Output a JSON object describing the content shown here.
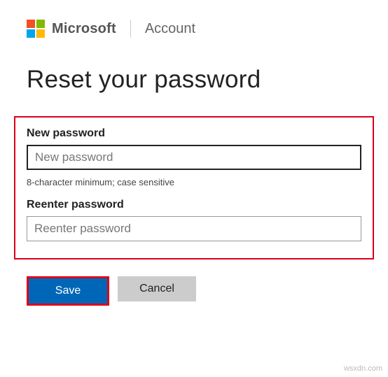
{
  "header": {
    "brand": "Microsoft",
    "section": "Account"
  },
  "page": {
    "title": "Reset your password"
  },
  "form": {
    "new_password": {
      "label": "New password",
      "placeholder": "New password",
      "hint": "8-character minimum; case sensitive"
    },
    "reenter_password": {
      "label": "Reenter password",
      "placeholder": "Reenter password"
    }
  },
  "buttons": {
    "save": "Save",
    "cancel": "Cancel"
  },
  "watermark": "wsxdn.com",
  "colors": {
    "highlight_border": "#d9001b",
    "primary_button": "#0067b8"
  }
}
